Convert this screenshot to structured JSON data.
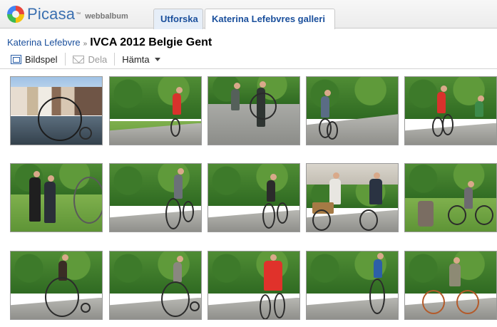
{
  "header": {
    "logo_text": "Picasa",
    "logo_tm": "™",
    "logo_sub": "webbalbum",
    "tabs": [
      {
        "label": "Utforska"
      },
      {
        "label": "Katerina Lefebvres galleri"
      }
    ]
  },
  "breadcrumb": {
    "user": "Katerina Lefebvre",
    "separator": "»",
    "album_title": "IVCA 2012 Belgie Gent"
  },
  "toolbar": {
    "slideshow_label": "Bildspel",
    "share_label": "Dela",
    "download_label": "Hämta"
  },
  "colors": {
    "link": "#1a4f9c",
    "title": "#000000",
    "disabled": "#9a9a9a"
  },
  "photos": {
    "count_visible": 15,
    "columns": 5,
    "rows": 3
  }
}
